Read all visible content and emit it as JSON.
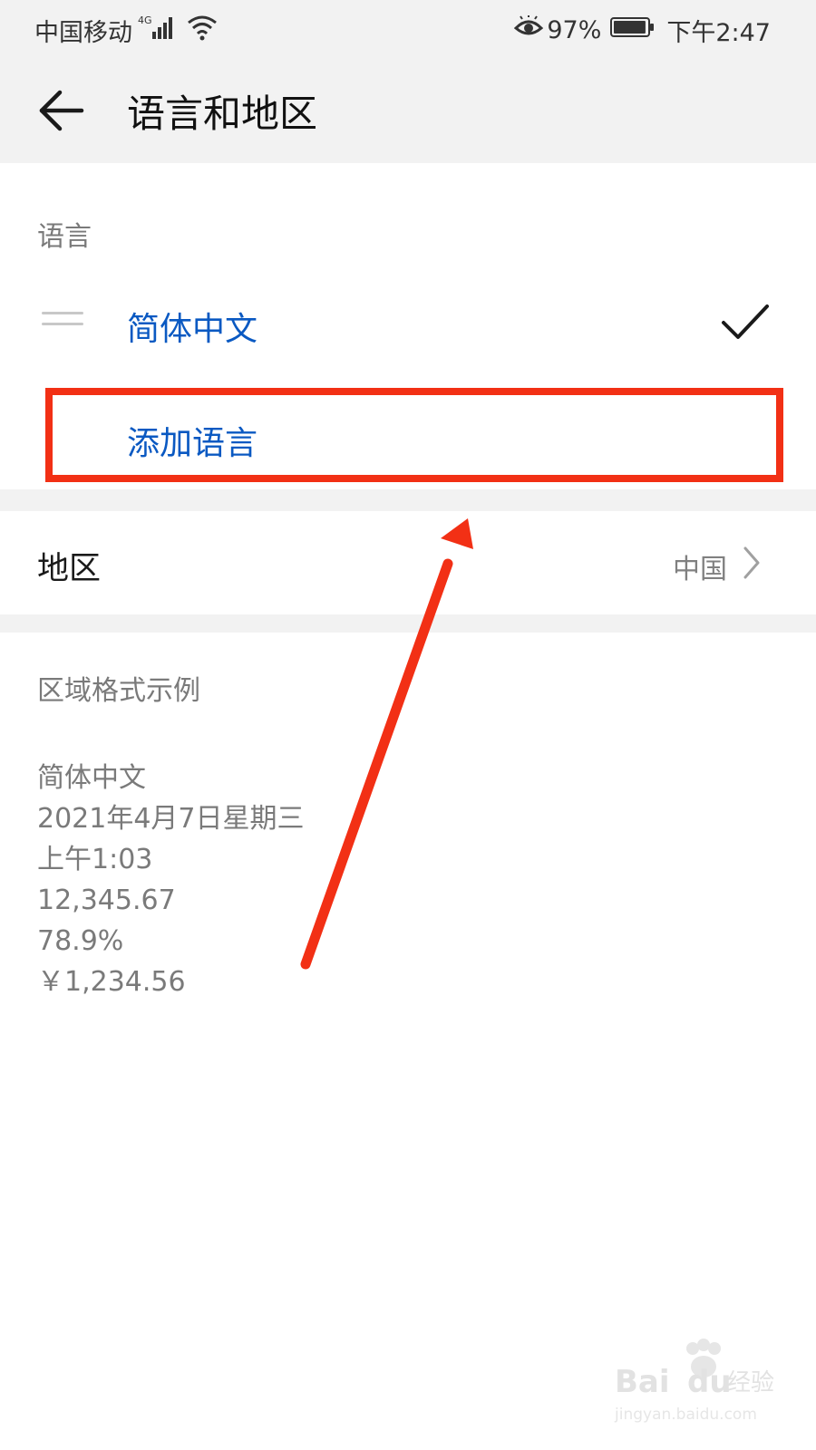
{
  "status_bar": {
    "carrier": "中国移动",
    "network": "4G",
    "battery_percent": "97%",
    "battery_level": 0.97,
    "time": "下午2:47"
  },
  "app_bar": {
    "title": "语言和地区"
  },
  "language_section": {
    "label": "语言",
    "items": [
      {
        "name": "简体中文",
        "selected": true
      }
    ],
    "add_language_label": "添加语言"
  },
  "region": {
    "label": "地区",
    "value": "中国"
  },
  "format_sample": {
    "label": "区域格式示例",
    "lines": [
      "简体中文",
      "2021年4月7日星期三",
      "上午1:03",
      "12,345.67",
      "78.9%",
      "￥1,234.56"
    ]
  },
  "annotation": {
    "color": "#f23015"
  },
  "watermark": {
    "brand": "Bai du 经验",
    "url": "jingyan.baidu.com"
  },
  "colors": {
    "accent": "#0a59c2",
    "background_band": "#f2f2f2"
  }
}
